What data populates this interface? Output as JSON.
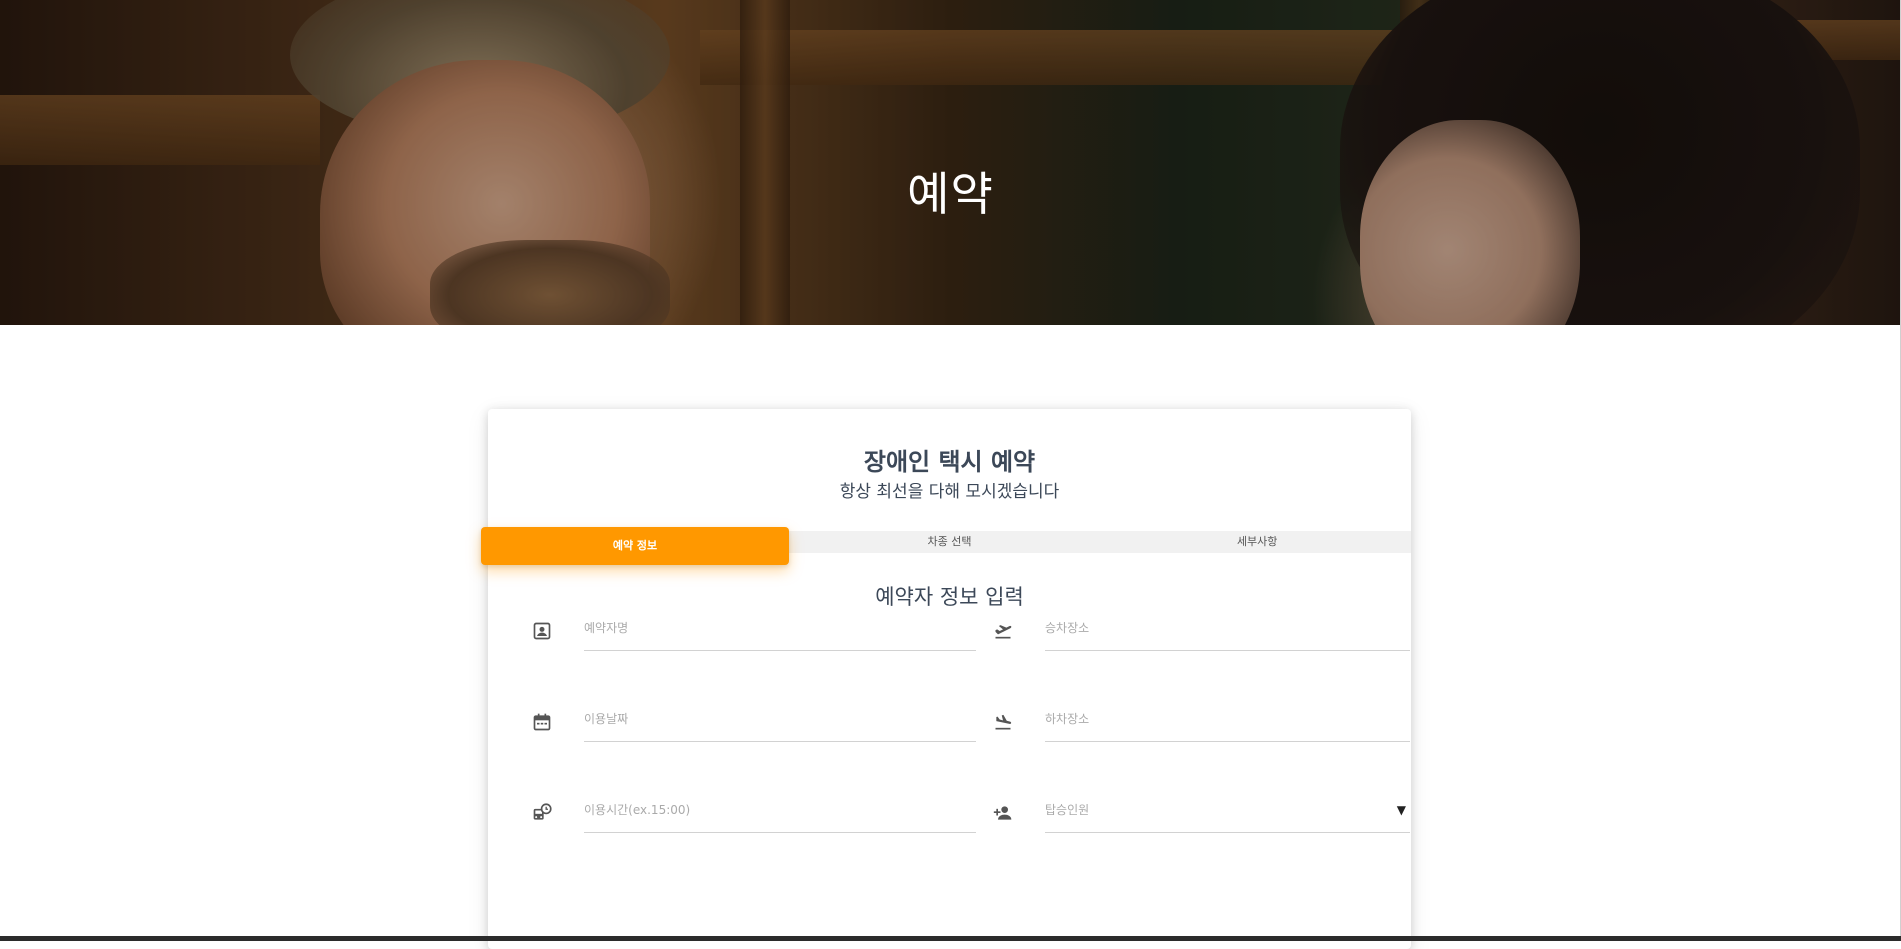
{
  "hero": {
    "title": "예약"
  },
  "card": {
    "title": "장애인 택시 예약",
    "subtitle": "항상 최선을 다해 모시겠습니다",
    "tabs": [
      {
        "label": "예약 정보",
        "active": true
      },
      {
        "label": "차종 선택",
        "active": false
      },
      {
        "label": "세부사항",
        "active": false
      }
    ],
    "section_title": "예약자 정보 입력",
    "accent_color": "#ff9800",
    "fields": {
      "name": {
        "placeholder": "예약자명",
        "icon": "contact-card-icon"
      },
      "pickup": {
        "placeholder": "승차장소",
        "icon": "flight-takeoff-icon"
      },
      "date": {
        "placeholder": "이용날짜",
        "icon": "calendar-icon"
      },
      "dropoff": {
        "placeholder": "하차장소",
        "icon": "flight-land-icon"
      },
      "time": {
        "placeholder": "이용시간(ex.15:00)",
        "icon": "transit-time-icon"
      },
      "passengers": {
        "placeholder": "탑승인원",
        "icon": "person-add-icon",
        "caret": "▼"
      }
    }
  }
}
